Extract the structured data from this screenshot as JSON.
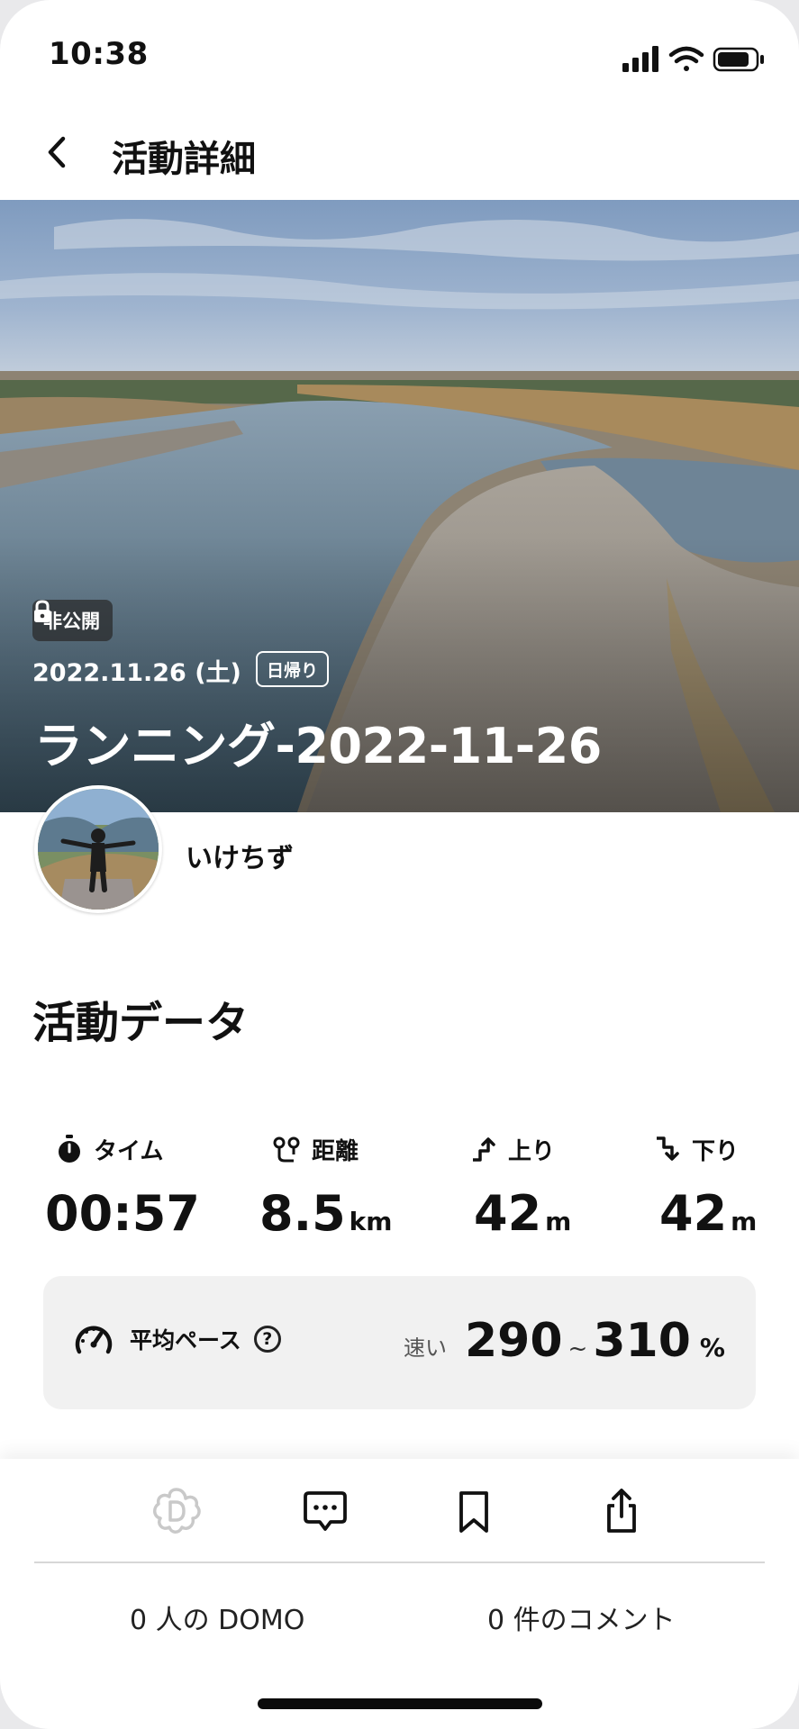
{
  "status_bar": {
    "time": "10:38"
  },
  "nav": {
    "title": "活動詳細",
    "back_icon": "chevron-left-icon"
  },
  "hero": {
    "visibility": "非公開",
    "date": "2022.11.26 (土)",
    "trip_type": "日帰り",
    "title": "ランニング-2022-11-26"
  },
  "user": {
    "name": "いけちず"
  },
  "activity": {
    "section_title": "活動データ",
    "stats": [
      {
        "icon": "stopwatch-icon",
        "label": "タイム",
        "value": "00:57",
        "unit": ""
      },
      {
        "icon": "route-icon",
        "label": "距離",
        "value": "8.5",
        "unit": "km"
      },
      {
        "icon": "ascent-icon",
        "label": "上り",
        "value": "42",
        "unit": "m"
      },
      {
        "icon": "descent-icon",
        "label": "下り",
        "value": "42",
        "unit": "m"
      }
    ],
    "pace": {
      "label": "平均ペース",
      "help": "?",
      "qualifier": "速い",
      "low": "290",
      "sep": "~",
      "high": "310",
      "unit": "%"
    }
  },
  "bottom": {
    "domo_count": "0 人の DOMO",
    "comment_count": "0 件のコメント"
  },
  "colors": {
    "accent": "#111111",
    "domo_inactive": "#c9c9c9",
    "pace_bg": "#f1f1f1"
  }
}
